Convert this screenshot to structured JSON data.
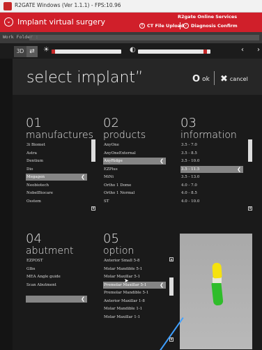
{
  "window": {
    "title": "R2GATE Windows (Ver 1.1.1) - FPS:10.96"
  },
  "app": {
    "title": "Implant virtual surgery",
    "online_services": "R2gate Online Services",
    "ct_upload": "CT File Upload",
    "diagnosis_confirm": "Diagnosis Confirm"
  },
  "workfolder": {
    "label": "Work Folder :"
  },
  "toolbar": {
    "tab_3d": "3D",
    "brightness_level": 0.05,
    "contrast_level": 0.95
  },
  "dialog": {
    "title": "select implant”",
    "ok": "ok",
    "cancel": "cancel"
  },
  "sections": {
    "manufactures": {
      "num": "01",
      "name": "manufactures",
      "items": [
        "3i Biomet",
        "Astra",
        "Dentium",
        "Dio",
        "Megagen",
        "Neobiotech",
        "NobelBiocare",
        "Osstem"
      ],
      "selected": "Megagen"
    },
    "products": {
      "num": "02",
      "name": "products",
      "items": [
        "AnyOne",
        "AnyOneExternal",
        "AnyRidge",
        "EZPlus",
        "MiNi",
        "Ortho 1 Dome",
        "Ortho 1 Normal",
        "ST"
      ],
      "selected": "AnyRidge"
    },
    "information": {
      "num": "03",
      "name": "information",
      "items": [
        "3.5 - 7.0",
        "3.5 - 8.5",
        "3.5 - 10.0",
        "3.5 - 11.5",
        "3.5 - 13.0",
        "4.0 - 7.0",
        "4.0 - 8.5",
        "4.0 - 10.0"
      ],
      "selected": "3.5 - 11.5"
    },
    "abutment": {
      "num": "04",
      "name": "abutment",
      "items": [
        "EZPOST",
        "Glbs",
        "MEA Angle guide",
        "Scan Abutment"
      ],
      "selected": ""
    },
    "option": {
      "num": "05",
      "name": "option",
      "items": [
        "Anterior Small 5-8",
        "Molar Mandible 5-1",
        "Molar Maxillar 5-1",
        "Premolar Maxillar 5-1",
        "Premolar Mandible 5-1",
        "Anterior Maxillar 1-8",
        "Molar Mandible 1-1",
        "Molar Maxillar 1-1"
      ],
      "selected": "Premolar Maxillar 5-1"
    }
  },
  "colors": {
    "accent": "#d01f2a",
    "selection": "#858585",
    "implant_crown": "#f5e20f",
    "implant_body": "#2fbd2a"
  }
}
